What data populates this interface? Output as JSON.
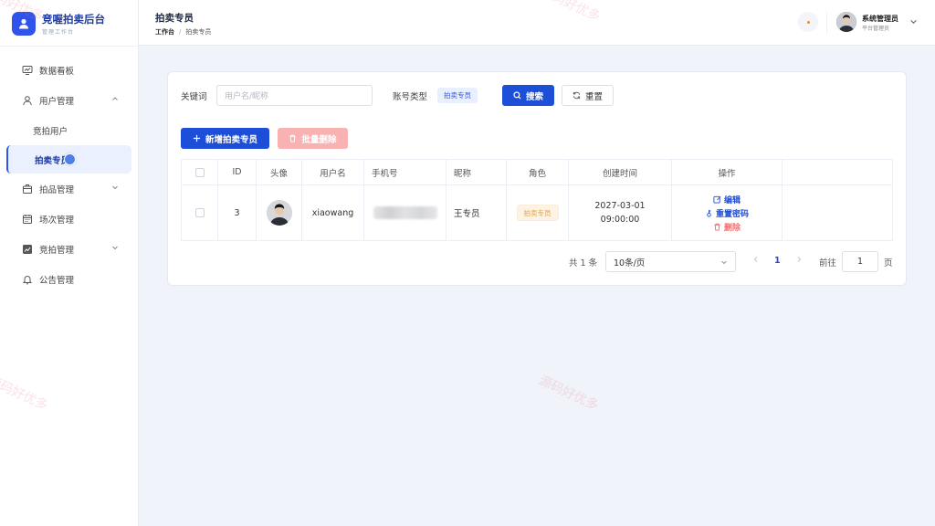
{
  "brand": {
    "title": "竞喔拍卖后台",
    "subtitle": "管理工作台"
  },
  "sidebar": {
    "items": [
      {
        "label": "数据看板",
        "icon": "dashboard-icon"
      },
      {
        "label": "用户管理",
        "icon": "user-icon",
        "expanded": true
      },
      {
        "label": "竞拍用户"
      },
      {
        "label": "拍卖专员",
        "active": true
      },
      {
        "label": "拍品管理",
        "icon": "box-icon",
        "expanded": false
      },
      {
        "label": "场次管理",
        "icon": "calendar-icon"
      },
      {
        "label": "竞拍管理",
        "icon": "chart-icon",
        "expanded": false
      },
      {
        "label": "公告管理",
        "icon": "bell-icon"
      }
    ]
  },
  "header": {
    "title": "拍卖专员",
    "breadcrumb": {
      "home": "工作台",
      "sep": "/",
      "current": "拍卖专员"
    },
    "user": {
      "name": "系统管理员",
      "role": "平台管理员"
    }
  },
  "filters": {
    "keyword_label": "关键词",
    "keyword_placeholder": "用户名/昵称",
    "account_type_label": "账号类型",
    "account_type_tag": "拍卖专员",
    "search_label": "搜索",
    "reset_label": "重置"
  },
  "actions": {
    "add_label": "新增拍卖专员",
    "batch_delete_label": "批量删除"
  },
  "table": {
    "headers": [
      "ID",
      "头像",
      "用户名",
      "手机号",
      "昵称",
      "角色",
      "创建时间",
      "操作"
    ],
    "rows": [
      {
        "id": "3",
        "username": "xiaowang",
        "nickname": "王专员",
        "role": "拍卖专员",
        "created_date": "2027-03-01",
        "created_time": "09:00:00",
        "ops": {
          "edit": "编辑",
          "reset_pwd": "重置密码",
          "delete": "删除"
        }
      }
    ]
  },
  "pagination": {
    "total": "共 1 条",
    "page_size": "10条/页",
    "current": "1",
    "goto_label": "前往",
    "goto_value": "1",
    "page_suffix": "页"
  },
  "watermark": "源码好优多",
  "colors": {
    "primary": "#1d4ed8",
    "danger": "#f56c6c",
    "warning": "#e6a23c"
  }
}
